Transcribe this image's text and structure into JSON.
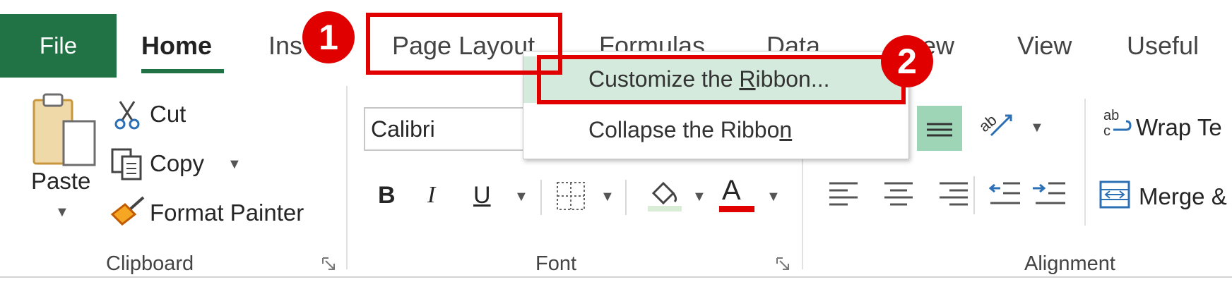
{
  "tabs": {
    "file": "File",
    "home": "Home",
    "insert_partial": "Ins",
    "page_layout": "Page Layout",
    "formulas": "Formulas",
    "data": "Data",
    "review_partial": "ew",
    "view": "View",
    "useful": "Useful"
  },
  "clipboard": {
    "paste": "Paste",
    "cut": "Cut",
    "copy": "Copy",
    "format_painter": "Format Painter",
    "group_label": "Clipboard"
  },
  "font": {
    "font_name": "Calibri",
    "bold": "B",
    "italic": "I",
    "underline": "U",
    "font_color_glyph": "A",
    "group_label": "Font"
  },
  "alignment": {
    "wrap_text": "Wrap Te",
    "merge": "Merge &",
    "group_label": "Alignment"
  },
  "context_menu": {
    "customize_prefix": "Customize the ",
    "customize_accel": "R",
    "customize_suffix": "ibbon...",
    "collapse_prefix": "Collapse the Ribbo",
    "collapse_accel": "n"
  },
  "annotations": {
    "step1": "1",
    "step2": "2"
  },
  "colors": {
    "file_tab": "#217346",
    "annotation_red": "#e00000",
    "menu_highlight": "#d3eadc",
    "font_color_bar": "#e00000"
  }
}
